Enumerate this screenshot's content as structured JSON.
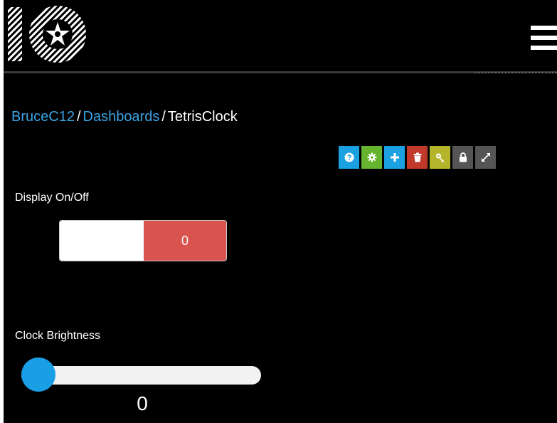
{
  "header": {
    "logo_icon": "adafruit-io-logo",
    "menu_icon": "hamburger-menu-icon"
  },
  "breadcrumb": {
    "user": "BruceC12",
    "section": "Dashboards",
    "current": "TetrisClock",
    "separator": "/"
  },
  "toolbar": {
    "buttons": [
      {
        "name": "help",
        "icon": "question-circle-icon",
        "color": "#1ba1e2"
      },
      {
        "name": "settings",
        "icon": "gear-icon",
        "color": "#65b32e"
      },
      {
        "name": "add",
        "icon": "plus-icon",
        "color": "#1ba1e2"
      },
      {
        "name": "delete",
        "icon": "trash-icon",
        "color": "#c0392b"
      },
      {
        "name": "key",
        "icon": "key-icon",
        "color": "#b5b52b"
      },
      {
        "name": "lock",
        "icon": "lock-icon",
        "color": "#555555"
      },
      {
        "name": "fullscreen",
        "icon": "expand-icon",
        "color": "#555555"
      }
    ]
  },
  "toggle_widget": {
    "title": "Display On/Off",
    "off_value": "0",
    "state": "off",
    "off_color": "#d9534f"
  },
  "slider_widget": {
    "title": "Clock Brightness",
    "value": "0",
    "level": 0,
    "thumb_color": "#1a9ee6"
  },
  "colors": {
    "background": "#000000",
    "link": "#3aa3e3"
  }
}
